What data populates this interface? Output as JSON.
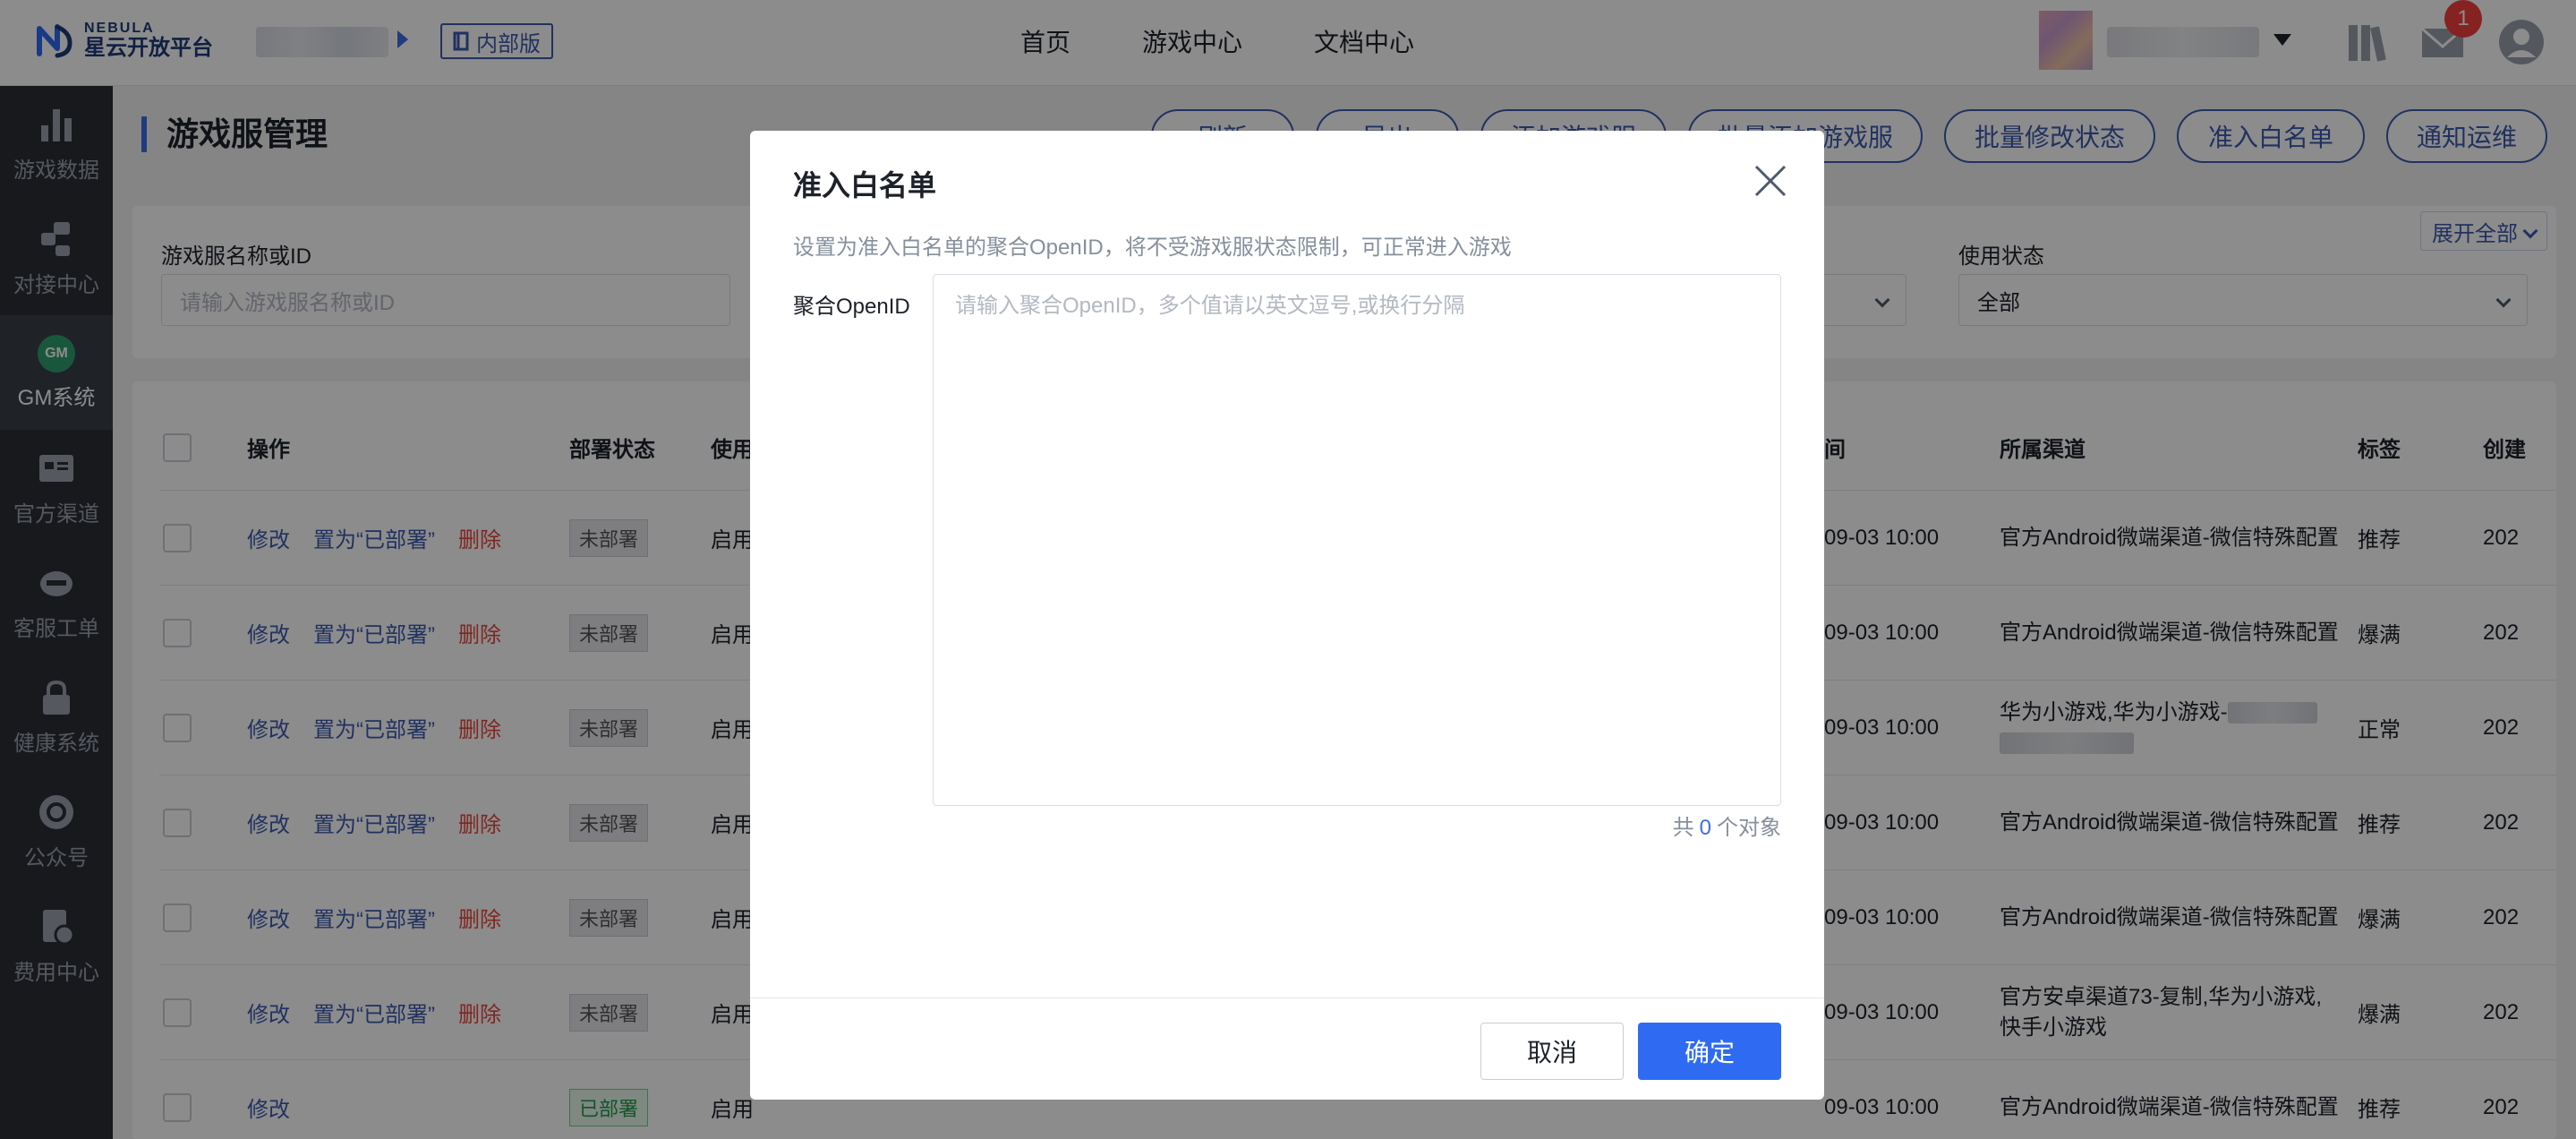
{
  "header": {
    "logo_en": "NEBULA",
    "logo_cn": "星云开放平台",
    "internal_label": "内部版",
    "nav": [
      "首页",
      "游戏中心",
      "文档中心"
    ],
    "message_count": "1"
  },
  "sidebar": {
    "items": [
      {
        "label": "游戏数据",
        "icon": "bar-chart-icon"
      },
      {
        "label": "对接中心",
        "icon": "connect-icon"
      },
      {
        "label": "GM系统",
        "icon": "gm-icon",
        "active": true,
        "badge": "GM"
      },
      {
        "label": "官方渠道",
        "icon": "channel-card-icon"
      },
      {
        "label": "客服工单",
        "icon": "headset-icon"
      },
      {
        "label": "健康系统",
        "icon": "lock-icon"
      },
      {
        "label": "公众号",
        "icon": "refresh-circle-icon"
      },
      {
        "label": "费用中心",
        "icon": "bill-icon"
      }
    ]
  },
  "page": {
    "title": "游戏服管理",
    "actions": [
      "刷新",
      "导出",
      "添加游戏服",
      "批量添加游戏服",
      "批量修改状态",
      "准入白名单",
      "通知运维"
    ],
    "expand_all": "展开全部",
    "filters": {
      "name_label": "游戏服名称或ID",
      "name_placeholder": "请输入游戏服名称或ID",
      "usage_label": "使用状态",
      "usage_value": "全部"
    },
    "table": {
      "headers": [
        "操作",
        "部署状态",
        "使用",
        "间",
        "所属渠道",
        "标签",
        "创建"
      ],
      "actions": {
        "edit": "修改",
        "set_deployed": "置为“已部署”",
        "delete": "删除"
      },
      "rows": [
        {
          "deploy": "未部署",
          "deployed": false,
          "usage": "启用",
          "time": "09-03 10:00",
          "channel": "官方Android微端渠道-微信特殊配置",
          "tag": "推荐",
          "created": "202"
        },
        {
          "deploy": "未部署",
          "deployed": false,
          "usage": "启用",
          "time": "09-03 10:00",
          "channel": "官方Android微端渠道-微信特殊配置",
          "tag": "爆满",
          "created": "202"
        },
        {
          "deploy": "未部署",
          "deployed": false,
          "usage": "启用",
          "time": "09-03 10:00",
          "channel": "华为小游戏,华为小游戏-",
          "tag": "正常",
          "created": "202"
        },
        {
          "deploy": "未部署",
          "deployed": false,
          "usage": "启用",
          "time": "09-03 10:00",
          "channel": "官方Android微端渠道-微信特殊配置",
          "tag": "推荐",
          "created": "202"
        },
        {
          "deploy": "未部署",
          "deployed": false,
          "usage": "启用",
          "time": "09-03 10:00",
          "channel": "官方Android微端渠道-微信特殊配置",
          "tag": "爆满",
          "created": "202"
        },
        {
          "deploy": "未部署",
          "deployed": false,
          "usage": "启用",
          "time": "09-03 10:00",
          "channel": "官方安卓渠道73-复制,华为小游戏,快手小游戏",
          "tag": "爆满",
          "created": "202"
        },
        {
          "deploy": "已部署",
          "deployed": true,
          "usage": "启用",
          "time": "09-03 10:00",
          "channel": "官方Android微端渠道-微信特殊配置",
          "tag": "推荐",
          "created": "202"
        }
      ]
    }
  },
  "modal": {
    "title": "准入白名单",
    "description": "设置为准入白名单的聚合OpenID，将不受游戏服状态限制，可正常进入游戏",
    "field_label": "聚合OpenID",
    "placeholder": "请输入聚合OpenID，多个值请以英文逗号,或换行分隔",
    "value": "",
    "counter_prefix": "共",
    "counter_value": "0",
    "counter_suffix": "个对象",
    "cancel": "取消",
    "confirm": "确定"
  },
  "colors": {
    "primary": "#2f6bf2",
    "danger": "#e8463d",
    "success": "#1f9c4a",
    "sidebar_bg": "#2a2e35"
  }
}
